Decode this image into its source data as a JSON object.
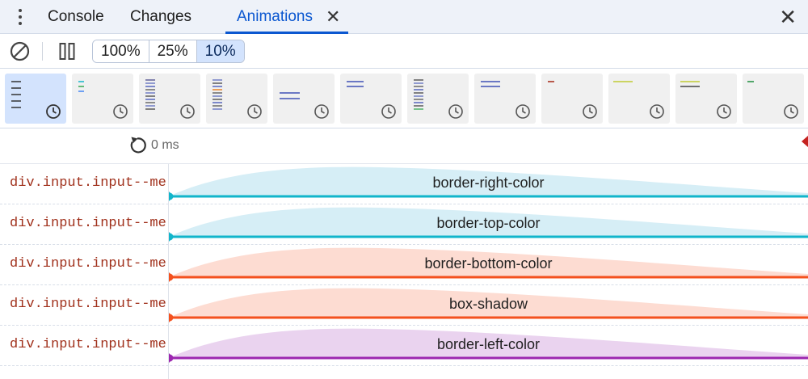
{
  "tabs": {
    "console": "Console",
    "changes": "Changes",
    "animations": "Animations",
    "close_glyph": "✕",
    "panel_close_glyph": "✕"
  },
  "toolbar": {
    "clear_icon": "clear-circle-slash-icon",
    "pause_icon": "pause-all-icon",
    "rates": [
      {
        "label": "100%",
        "active": false
      },
      {
        "label": "25%",
        "active": false
      },
      {
        "label": "10%",
        "active": true
      }
    ]
  },
  "previews": [
    {
      "selected": true,
      "style": "dark-stack"
    },
    {
      "selected": false,
      "style": "cyan-green"
    },
    {
      "selected": false,
      "style": "multi-dense"
    },
    {
      "selected": false,
      "style": "multi-dense-2"
    },
    {
      "selected": false,
      "style": "blue-double-low"
    },
    {
      "selected": false,
      "style": "blue-double"
    },
    {
      "selected": false,
      "style": "multi-green"
    },
    {
      "selected": false,
      "style": "blue-double-2"
    },
    {
      "selected": false,
      "style": "red-single"
    },
    {
      "selected": false,
      "style": "yellow-single"
    },
    {
      "selected": false,
      "style": "yellow-double"
    },
    {
      "selected": false,
      "style": "green-single"
    }
  ],
  "timeline": {
    "time_label": "0 ms",
    "replay_icon": "replay-icon"
  },
  "rows": [
    {
      "node": "div.input.input--me",
      "property": "border-right-color",
      "color": "#12b5cb",
      "fill": "#d6eef6"
    },
    {
      "node": "div.input.input--me",
      "property": "border-top-color",
      "color": "#12b5cb",
      "fill": "#d6eef6"
    },
    {
      "node": "div.input.input--me",
      "property": "border-bottom-color",
      "color": "#f4511e",
      "fill": "#fddcd2"
    },
    {
      "node": "div.input.input--me",
      "property": "box-shadow",
      "color": "#f4511e",
      "fill": "#fddcd2"
    },
    {
      "node": "div.input.input--me",
      "property": "border-left-color",
      "color": "#9c27b0",
      "fill": "#ead3ef"
    }
  ]
}
